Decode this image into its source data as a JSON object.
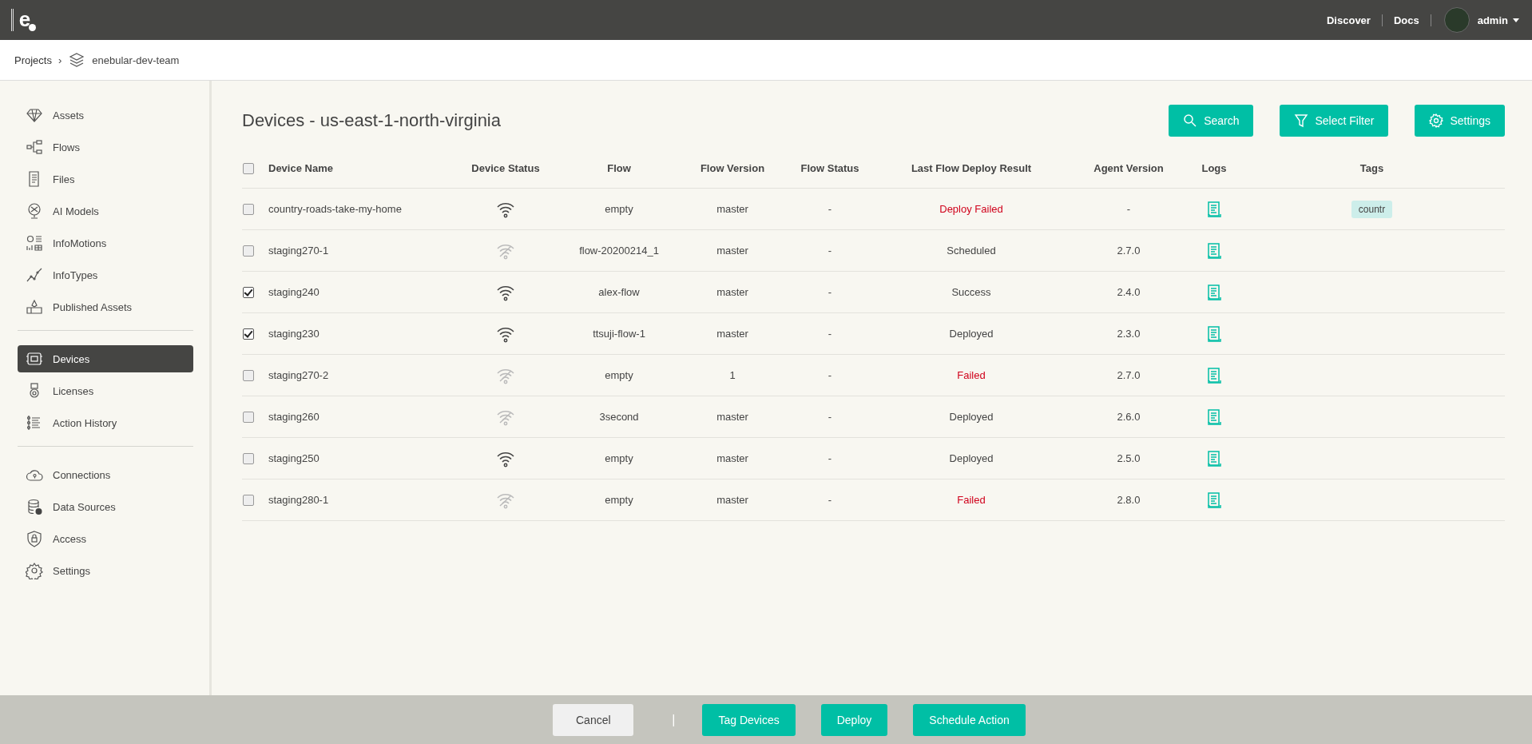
{
  "topbar": {
    "logo": "e",
    "links": [
      "Discover",
      "Docs"
    ],
    "user": "admin"
  },
  "breadcrumb": {
    "root": "Projects",
    "separator": "›",
    "project": "enebular-dev-team"
  },
  "sidebar": {
    "groups": [
      [
        {
          "label": "Assets",
          "selected": false
        },
        {
          "label": "Flows",
          "selected": false
        },
        {
          "label": "Files",
          "selected": false
        },
        {
          "label": "AI Models",
          "selected": false
        },
        {
          "label": "InfoMotions",
          "selected": false
        },
        {
          "label": "InfoTypes",
          "selected": false
        },
        {
          "label": "Published Assets",
          "selected": false
        }
      ],
      [
        {
          "label": "Devices",
          "selected": true
        },
        {
          "label": "Licenses",
          "selected": false
        },
        {
          "label": "Action History",
          "selected": false
        }
      ],
      [
        {
          "label": "Connections",
          "selected": false
        },
        {
          "label": "Data Sources",
          "selected": false
        },
        {
          "label": "Access",
          "selected": false
        },
        {
          "label": "Settings",
          "selected": false
        }
      ]
    ]
  },
  "page_title": "Devices - us-east-1-north-virginia",
  "toolbar": [
    {
      "kind": "search",
      "label": "Search"
    },
    {
      "kind": "filter",
      "label": "Select Filter"
    },
    {
      "kind": "settings",
      "label": "Settings"
    }
  ],
  "table": {
    "select_all": {
      "checked": false
    },
    "columns": [
      "Device Name",
      "Device Status",
      "Flow",
      "Flow Version",
      "Flow Status",
      "Last Flow Deploy Result",
      "Agent Version",
      "Logs",
      "Tags"
    ],
    "rows": [
      {
        "checked": false,
        "name": "country-roads-take-my-home",
        "online": true,
        "flow": "empty",
        "flow_version": "master",
        "flow_status": "-",
        "deploy_result": "Deploy Failed",
        "failed": true,
        "agent_version": "-",
        "tags": [
          "countr"
        ]
      },
      {
        "checked": false,
        "name": "staging270-1",
        "online": false,
        "flow": "flow-20200214_1",
        "flow_version": "master",
        "flow_status": "-",
        "deploy_result": "Scheduled",
        "failed": false,
        "agent_version": "2.7.0",
        "tags": []
      },
      {
        "checked": true,
        "name": "staging240",
        "online": true,
        "flow": "alex-flow",
        "flow_version": "master",
        "flow_status": "-",
        "deploy_result": "Success",
        "failed": false,
        "agent_version": "2.4.0",
        "tags": []
      },
      {
        "checked": true,
        "name": "staging230",
        "online": true,
        "flow": "ttsuji-flow-1",
        "flow_version": "master",
        "flow_status": "-",
        "deploy_result": "Deployed",
        "failed": false,
        "agent_version": "2.3.0",
        "tags": []
      },
      {
        "checked": false,
        "name": "staging270-2",
        "online": false,
        "flow": "empty",
        "flow_version": "1",
        "flow_status": "-",
        "deploy_result": "Failed",
        "failed": true,
        "agent_version": "2.7.0",
        "tags": []
      },
      {
        "checked": false,
        "name": "staging260",
        "online": false,
        "flow": "3second",
        "flow_version": "master",
        "flow_status": "-",
        "deploy_result": "Deployed",
        "failed": false,
        "agent_version": "2.6.0",
        "tags": []
      },
      {
        "checked": false,
        "name": "staging250",
        "online": true,
        "flow": "empty",
        "flow_version": "master",
        "flow_status": "-",
        "deploy_result": "Deployed",
        "failed": false,
        "agent_version": "2.5.0",
        "tags": []
      },
      {
        "checked": false,
        "name": "staging280-1",
        "online": false,
        "flow": "empty",
        "flow_version": "master",
        "flow_status": "-",
        "deploy_result": "Failed",
        "failed": true,
        "agent_version": "2.8.0",
        "tags": []
      }
    ]
  },
  "footer": {
    "cancel": "Cancel",
    "separator": "|",
    "actions": [
      "Tag Devices",
      "Deploy",
      "Schedule Action"
    ]
  }
}
